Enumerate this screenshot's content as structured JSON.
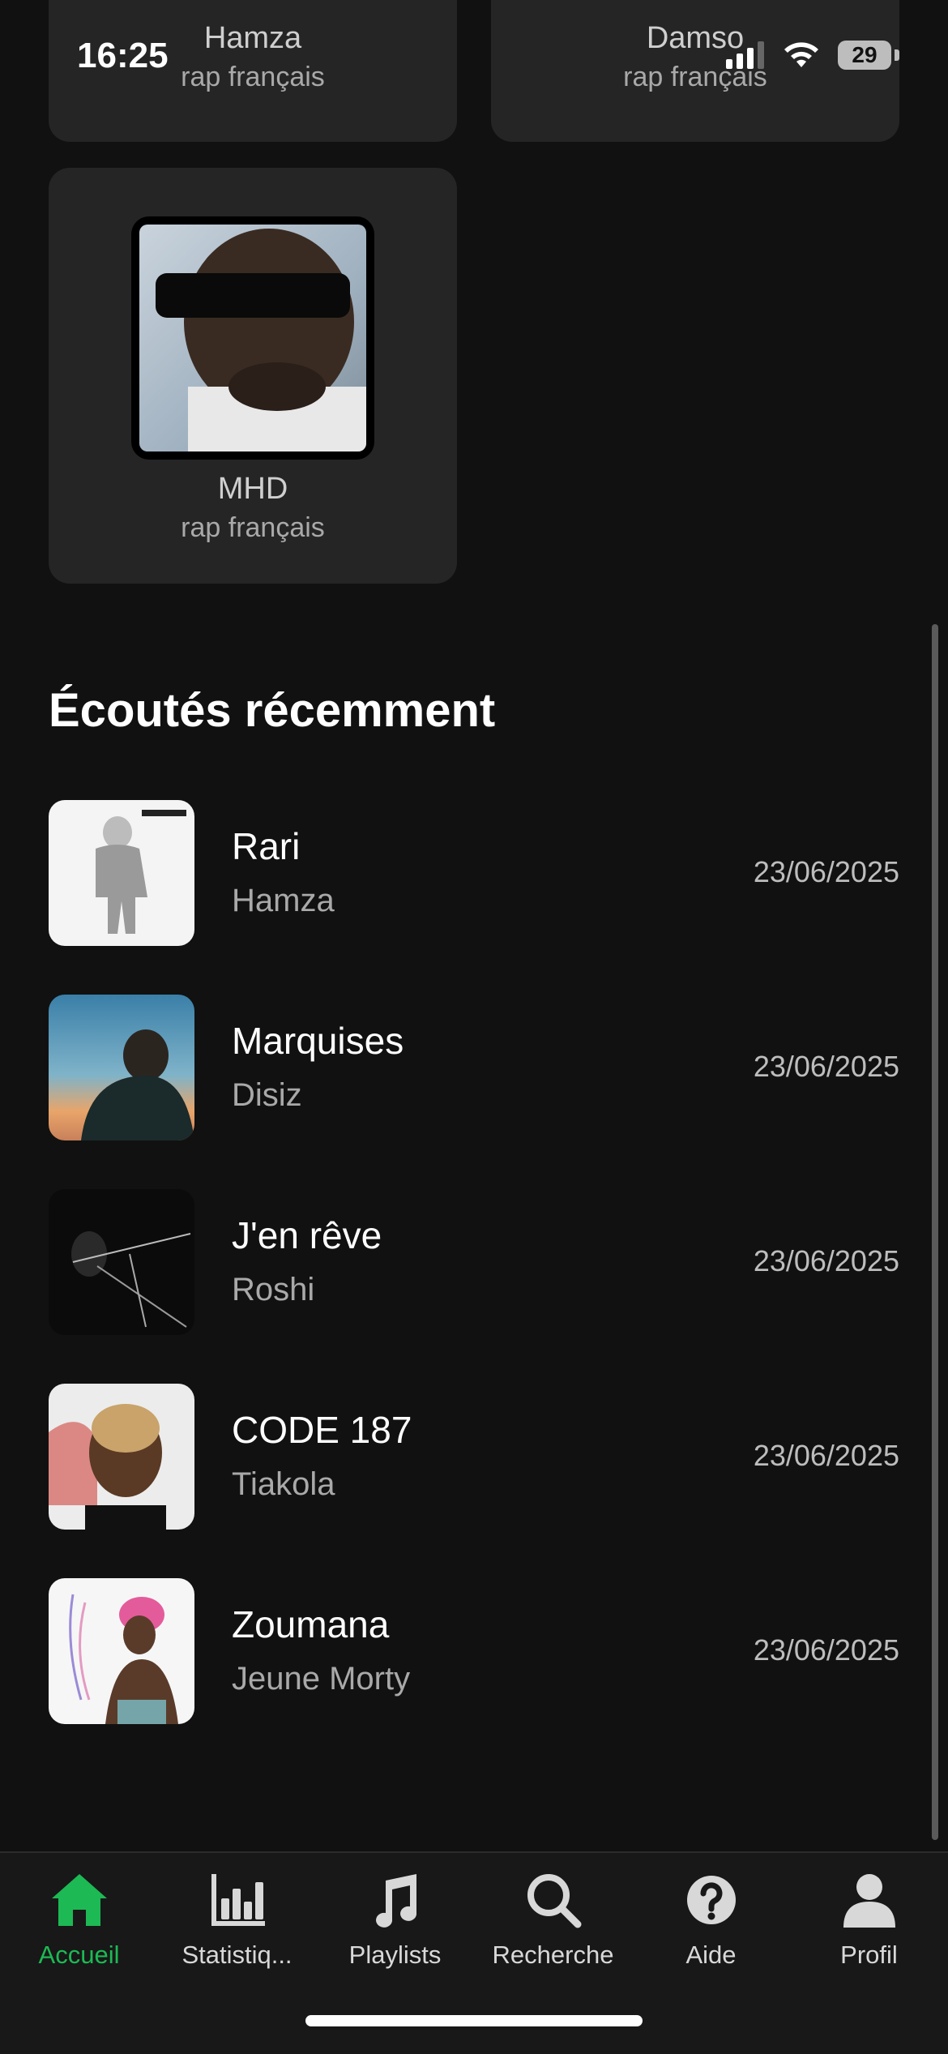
{
  "status_bar": {
    "time": "16:25",
    "battery": "29"
  },
  "artists": [
    {
      "name": "Hamza",
      "genre": "rap français"
    },
    {
      "name": "Damso",
      "genre": "rap français"
    },
    {
      "name": "MHD",
      "genre": "rap français"
    }
  ],
  "recent": {
    "title": "Écoutés récemment",
    "items": [
      {
        "title": "Rari",
        "artist": "Hamza",
        "date": "23/06/2025"
      },
      {
        "title": "Marquises",
        "artist": "Disiz",
        "date": "23/06/2025"
      },
      {
        "title": "J'en rêve",
        "artist": "Roshi",
        "date": "23/06/2025"
      },
      {
        "title": "CODE 187",
        "artist": "Tiakola",
        "date": "23/06/2025"
      },
      {
        "title": "Zoumana",
        "artist": "Jeune Morty",
        "date": "23/06/2025"
      }
    ]
  },
  "tabs": [
    {
      "label": "Accueil",
      "icon": "home-icon"
    },
    {
      "label": "Statistiq...",
      "icon": "bar-chart-icon"
    },
    {
      "label": "Playlists",
      "icon": "music-note-icon"
    },
    {
      "label": "Recherche",
      "icon": "search-icon"
    },
    {
      "label": "Aide",
      "icon": "help-icon"
    },
    {
      "label": "Profil",
      "icon": "profile-icon"
    }
  ],
  "colors": {
    "accent": "#1db954",
    "background": "#111111",
    "card": "#252525"
  }
}
